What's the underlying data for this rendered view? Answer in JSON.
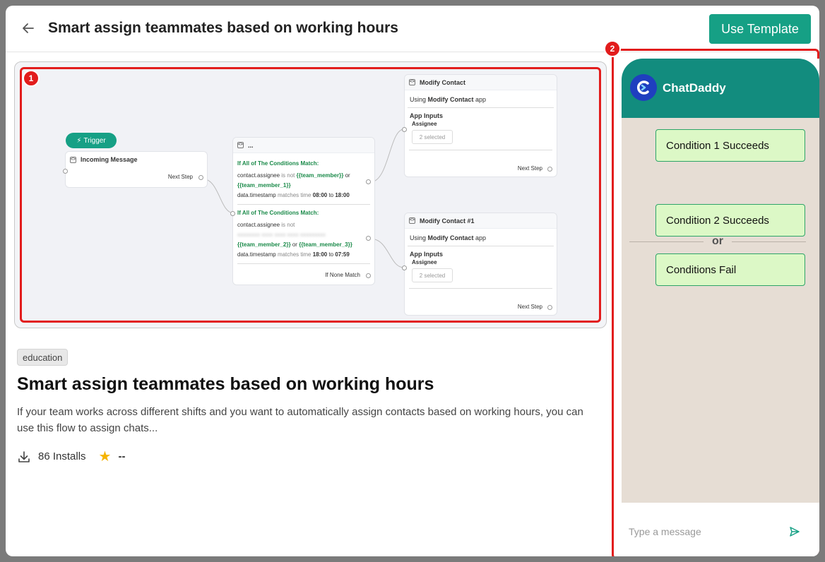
{
  "header": {
    "title": "Smart assign teammates based on working hours",
    "use_template_label": "Use Template"
  },
  "markers": {
    "preview": "1",
    "chat": "2"
  },
  "flow": {
    "trigger_label": "Trigger",
    "incoming": {
      "title": "Incoming Message",
      "next": "Next Step"
    },
    "condition_node": {
      "title": "...",
      "group1": {
        "heading": "If All of The Conditions Match:",
        "line1_field": "contact.assignee",
        "line1_op": "is not",
        "line1_value": "{{team_member}}",
        "line1_join": "or",
        "line2_value": "{{team_member_1}}",
        "line3_field": "data.timestamp",
        "line3_op": "matches time",
        "line3_from": "08:00",
        "line3_to_word": "to",
        "line3_to": "18:00"
      },
      "group2": {
        "heading": "If All of The Conditions Match:",
        "line1_field": "contact.assignee",
        "line1_op": "is not",
        "line2_value_a": "{{team_member_2}}",
        "line2_join": "or",
        "line2_value_b": "{{team_member_3}}",
        "line3_field": "data.timestamp",
        "line3_op": "matches time",
        "line3_from": "18:00",
        "line3_to_word": "to",
        "line3_to": "07:59"
      },
      "none_match": "If None Match"
    },
    "modify1": {
      "title": "Modify Contact",
      "using_prefix": "Using",
      "using_app": "Modify Contact",
      "using_suffix": "app",
      "inputs_label": "App Inputs",
      "assignee_label": "Assignee",
      "chip": "2 selected",
      "next": "Next Step"
    },
    "modify2": {
      "title": "Modify Contact #1",
      "using_prefix": "Using",
      "using_app": "Modify Contact",
      "using_suffix": "app",
      "inputs_label": "App Inputs",
      "assignee_label": "Assignee",
      "chip": "2 selected",
      "next": "Next Step"
    }
  },
  "details": {
    "tag": "education",
    "title": "Smart assign teammates based on working hours",
    "description": "If your team works across different shifts and you want to automatically assign contacts based on working hours, you can use this flow to assign chats...",
    "installs": "86 Installs",
    "rating": "--"
  },
  "chat": {
    "name": "ChatDaddy",
    "buttons": [
      "Condition 1 Succeeds",
      "Condition 2 Succeeds",
      "Conditions Fail"
    ],
    "or_label": "or",
    "input_placeholder": "Type a message"
  },
  "colors": {
    "accent": "#16a085",
    "chat_header": "#128c7e",
    "highlight": "#e21c1c",
    "bubble": "#dcf8c6"
  }
}
